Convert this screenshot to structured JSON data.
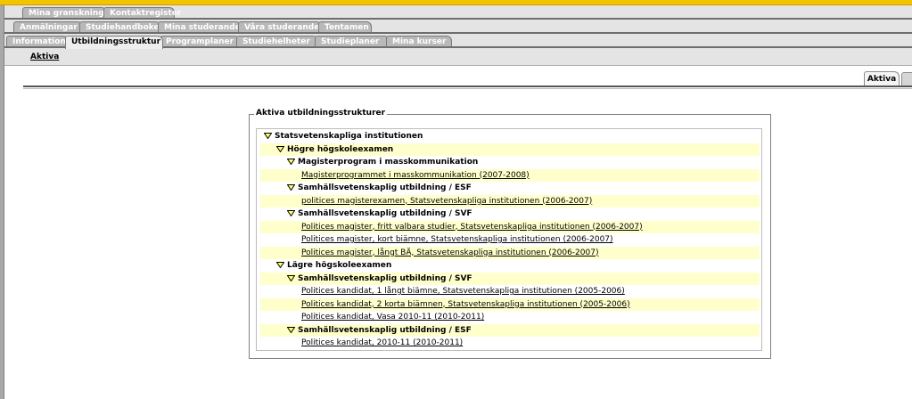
{
  "tabs": {
    "row1": [
      "Mina granskningar",
      "Kontaktregister"
    ],
    "row2": [
      "Anmälningar",
      "Studiehandboken",
      "Mina studerande",
      "Våra studerande",
      "Tentamen"
    ],
    "row3": [
      "Information",
      "Utbildningsstruktur",
      "Programplaner",
      "Studiehelheter",
      "Studieplaner",
      "Mina kurser"
    ],
    "active_row3": "Utbildningsstruktur"
  },
  "subnav": {
    "aktiva": "Aktiva"
  },
  "right_tab": {
    "label": "Aktiva"
  },
  "panel": {
    "legend": "Aktiva utbildningsstrukturer"
  },
  "tree": [
    {
      "label": "Statsvetenskapliga institutionen",
      "level": 0,
      "type": "folder",
      "highlight": false
    },
    {
      "label": "Högre högskoleexamen",
      "level": 1,
      "type": "folder",
      "highlight": true
    },
    {
      "label": "Magisterprogram i masskommunikation",
      "level": 2,
      "type": "folder",
      "highlight": false
    },
    {
      "label": "Magisterprogrammet i masskommunikation  (2007-2008)",
      "level": 3,
      "type": "link",
      "highlight": true
    },
    {
      "label": "Samhällsvetenskaplig utbildning / ESF",
      "level": 2,
      "type": "folder",
      "highlight": false
    },
    {
      "label": "politices magisterexamen, Statsvetenskapliga institutionen  (2006-2007)",
      "level": 3,
      "type": "link",
      "highlight": true
    },
    {
      "label": "Samhällsvetenskaplig utbildning / SVF",
      "level": 2,
      "type": "folder",
      "highlight": false
    },
    {
      "label": "Politices magister, fritt valbara studier, Statsvetenskapliga institutionen  (2006-2007)",
      "level": 3,
      "type": "link",
      "highlight": true
    },
    {
      "label": "Politices magister, kort biämne, Statsvetenskapliga institutionen  (2006-2007)",
      "level": 3,
      "type": "link",
      "highlight": false
    },
    {
      "label": "Politices magister, långt BÄ, Statsvetenskapliga institutionen  (2006-2007)",
      "level": 3,
      "type": "link",
      "highlight": true
    },
    {
      "label": "Lägre högskoleexamen",
      "level": 1,
      "type": "folder",
      "highlight": false
    },
    {
      "label": "Samhällsvetenskaplig utbildning / SVF",
      "level": 2,
      "type": "folder",
      "highlight": true
    },
    {
      "label": "Politices kandidat, 1 långt biämne, Statsvetenskapliga institutionen  (2005-2006)",
      "level": 3,
      "type": "link",
      "highlight": false
    },
    {
      "label": "Politices kandidat, 2 korta biämnen, Statsvetenskapliga institutionen  (2005-2006)",
      "level": 3,
      "type": "link",
      "highlight": true
    },
    {
      "label": "Politices kandidat, Vasa 2010-11  (2010-2011)",
      "level": 3,
      "type": "link",
      "highlight": false
    },
    {
      "label": "Samhällsvetenskaplig utbildning / ESF",
      "level": 2,
      "type": "folder",
      "highlight": true
    },
    {
      "label": "Politices kandidat, 2010-11  (2010-2011)",
      "level": 3,
      "type": "link",
      "highlight": false
    }
  ],
  "colors": {
    "accent": "#f5c400",
    "row_highlight": "#ffffcc",
    "tab_inactive": "#b9b9b9"
  }
}
